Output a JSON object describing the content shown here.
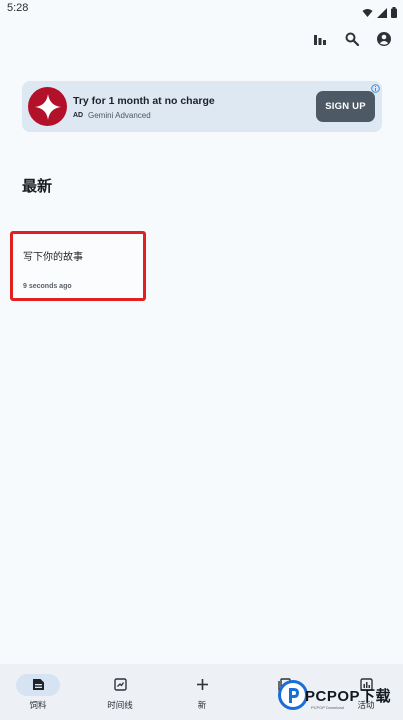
{
  "status_bar": {
    "time": "5:28"
  },
  "toolbar": {
    "icons": [
      "bar-chart-icon",
      "search-icon",
      "account-icon"
    ]
  },
  "ad": {
    "title": "Try for 1 month at no charge",
    "tag": "AD",
    "advertiser": "Gemini Advanced",
    "cta": "SIGN UP"
  },
  "section": {
    "title": "最新"
  },
  "story": {
    "title": "写下你的故事",
    "time": "9 seconds ago"
  },
  "bottom_nav": {
    "items": [
      {
        "label": "饲料",
        "icon": "feed-icon",
        "active": true
      },
      {
        "label": "时间线",
        "icon": "timeline-icon",
        "active": false
      },
      {
        "label": "新",
        "icon": "plus-icon",
        "active": false
      },
      {
        "label": "",
        "icon": "library-icon",
        "active": false
      },
      {
        "label": "活动",
        "icon": "activity-icon",
        "active": false
      }
    ]
  },
  "watermark": {
    "text": "PCPOP下载",
    "sub": "PCPOP Download"
  },
  "colors": {
    "background": "#f7fafd",
    "ad_background": "#dde8f3",
    "cta_background": "#4d5964",
    "highlight_border": "#e32020",
    "nav_active": "#d6e3f2"
  }
}
